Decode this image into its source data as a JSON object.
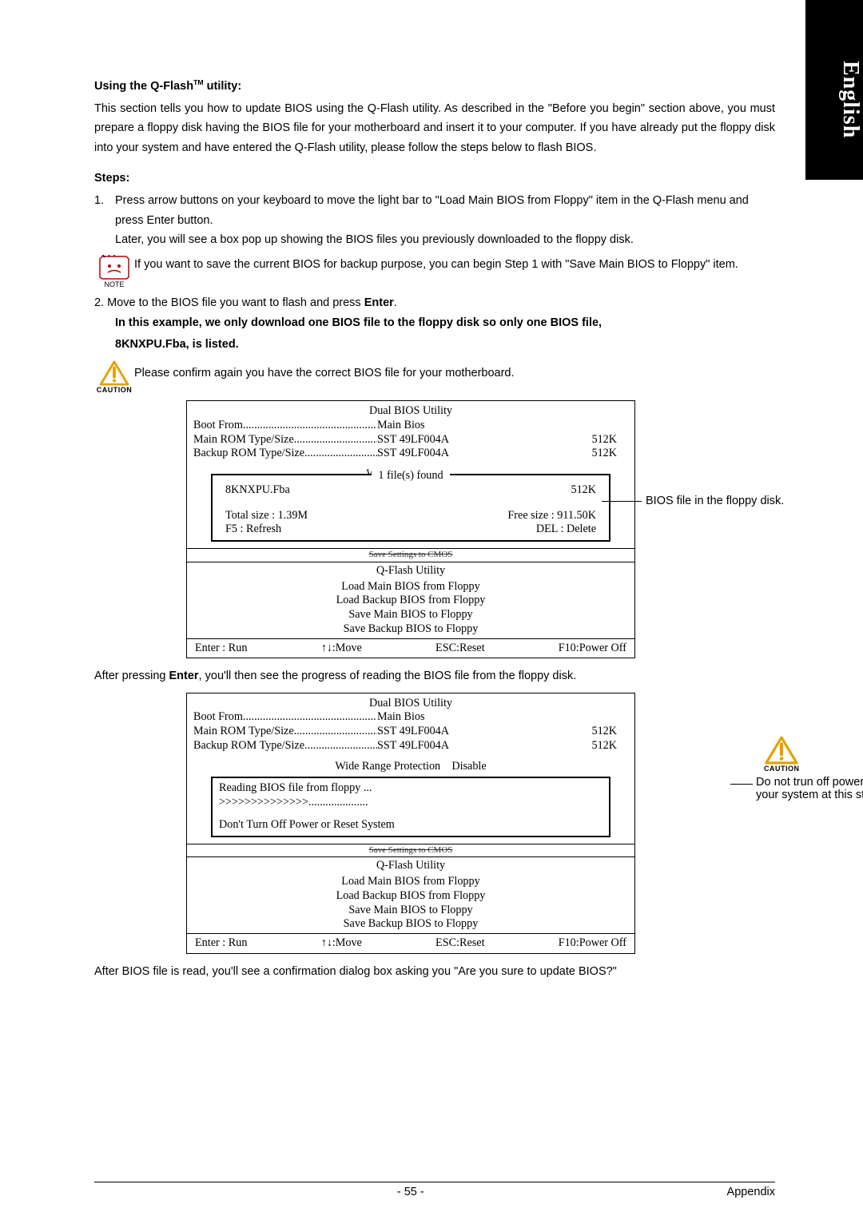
{
  "sideTab": "English",
  "heading1_pre": "Using the Q-Flash",
  "heading1_tm": "TM",
  "heading1_post": " utility:",
  "intro": "This section tells you how to update BIOS using the Q-Flash utility. As described in the \"Before you begin\" section above, you must prepare a floppy disk having the BIOS file for your motherboard and insert it to your computer. If you have already put the floppy disk into your system and have entered the Q-Flash utility, please follow the steps below to flash BIOS.",
  "stepsHeading": "Steps:",
  "step1_num": "1.",
  "step1_a": "Press arrow buttons on your keyboard to move the light bar to \"Load Main BIOS from Floppy\" item in the Q-Flash menu and press Enter button.",
  "step1_b": "Later, you will see a box pop up showing the BIOS files you previously downloaded to the floppy disk.",
  "noteLabel": "NOTE",
  "noteText": "If you want to save the current BIOS for backup purpose, you can begin Step 1 with \"Save Main BIOS to Floppy\" item.",
  "step2_pre": "2. Move to the BIOS file you want to flash and press ",
  "step2_bold": "Enter",
  "step2_post": ".",
  "exampleLine1": "In this example, we only download one BIOS file to the floppy disk so only one BIOS file,",
  "exampleLine2": "8KNXPU.Fba, is listed.",
  "cautionLabel": "CAUTION",
  "cautionText": "Please confirm again you have the correct BIOS file for your motherboard.",
  "bios": {
    "title": "Dual BIOS Utility",
    "row1_l": "Boot From",
    "row1_v": "Main Bios",
    "row2_l": "Main ROM Type/Size",
    "row2_v": "SST 49LF004A",
    "row2_s": "512K",
    "row3_l": "Backup ROM Type/Size",
    "row3_v": "SST 49LF004A",
    "row3_s": "512K",
    "wide_l": "Wide Range Prot",
    "wide_v": "Disable",
    "wide_full_l": "Wide Range Protection",
    "popupTitle": "1 file(s) found",
    "fileName": "8KNXPU.Fba",
    "fileSize": "512K",
    "total": "Total size : 1.39M",
    "free": "Free size : 911.50K",
    "f5": "F5 : Refresh",
    "del": "DEL : Delete",
    "savestrike": "Save Settings to CMOS",
    "qflash": "Q-Flash Utility",
    "m1": "Load Main BIOS from Floppy",
    "m2": "Load Backup BIOS from Floppy",
    "m3": "Save Main BIOS to Floppy",
    "m4": "Save Backup BIOS to Floppy",
    "f_enter": "Enter : Run",
    "f_move": "↑↓:Move",
    "f_esc": "ESC:Reset",
    "f_f10": "F10:Power Off"
  },
  "annot1": "BIOS file in the floppy disk.",
  "afterEnter_pre": "After pressing ",
  "afterEnter_bold": "Enter",
  "afterEnter_post": ", you'll then see the progress of reading the BIOS file from the floppy disk.",
  "reading": {
    "line1": "Reading BIOS file from floppy ...",
    "line2": ">>>>>>>>>>>>>>.....................",
    "line3": "Don't Turn Off Power or Reset System"
  },
  "cautionRight": "Do not trun off power or reset your system at this stage!!",
  "afterRead": "After BIOS file is read, you'll see a confirmation dialog box asking you \"Are you sure to update BIOS?\"",
  "pageNum": "- 55 -",
  "appendix": "Appendix"
}
